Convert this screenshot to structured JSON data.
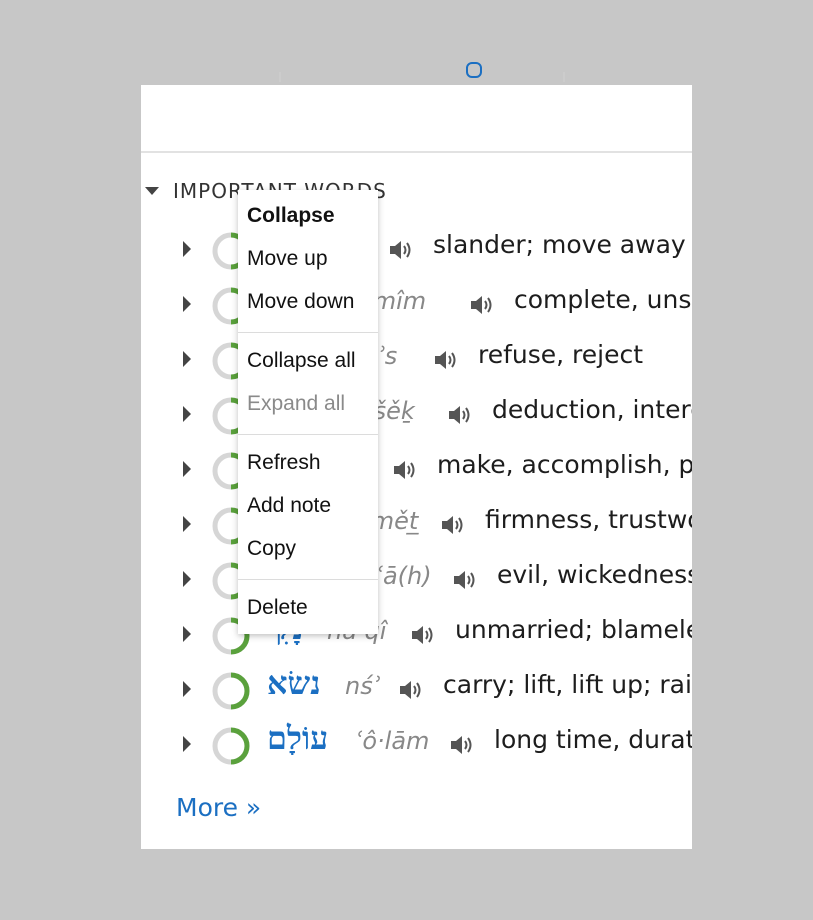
{
  "section": {
    "title": "IMPORTANT WORDS"
  },
  "words": [
    {
      "hebrew": "",
      "translit": "",
      "gloss": "slander; move away from",
      "icon": "speaker-icon"
    },
    {
      "hebrew": "",
      "translit": "tā·mîm",
      "gloss": "complete, unsound",
      "icon": "speaker-icon"
    },
    {
      "hebrew": "",
      "translit": "mʾs",
      "gloss": "refuse, reject",
      "icon": "speaker-icon"
    },
    {
      "hebrew": "",
      "translit": "ne·šěḵ",
      "gloss": "deduction, interest",
      "icon": "speaker-icon"
    },
    {
      "hebrew": "",
      "translit": "",
      "gloss": "make, accomplish, produce",
      "icon": "speaker-icon"
    },
    {
      "hebrew": "",
      "translit": "ʾě·mět̲",
      "gloss": "firmness, trustworthiness",
      "icon": "speaker-icon"
    },
    {
      "hebrew": "",
      "translit": "rāʿā(h)",
      "gloss": "evil, wickedness",
      "icon": "speaker-icon"
    },
    {
      "hebrew": "נָקִי",
      "translit": "nā·qî",
      "gloss": "unmarried; blameless",
      "icon": "speaker-icon"
    },
    {
      "hebrew": "נשׂא",
      "translit": "nśʾ",
      "gloss": "carry; lift, lift up; raise",
      "icon": "speaker-icon"
    },
    {
      "hebrew": "עוֹלָם",
      "translit": "ʿô·lām",
      "gloss": "long time, duration",
      "icon": "speaker-icon"
    }
  ],
  "more_link": "More »",
  "context_menu": {
    "collapse": "Collapse",
    "move_up": "Move up",
    "move_down": "Move down",
    "collapse_all": "Collapse all",
    "expand_all": "Expand all",
    "refresh": "Refresh",
    "add_note": "Add note",
    "copy": "Copy",
    "delete": "Delete"
  },
  "colors": {
    "accent": "#1b6fc2",
    "ring_fill": "#5aa13c",
    "ring_track": "#d6d6d6",
    "background": "#c7c7c7"
  }
}
